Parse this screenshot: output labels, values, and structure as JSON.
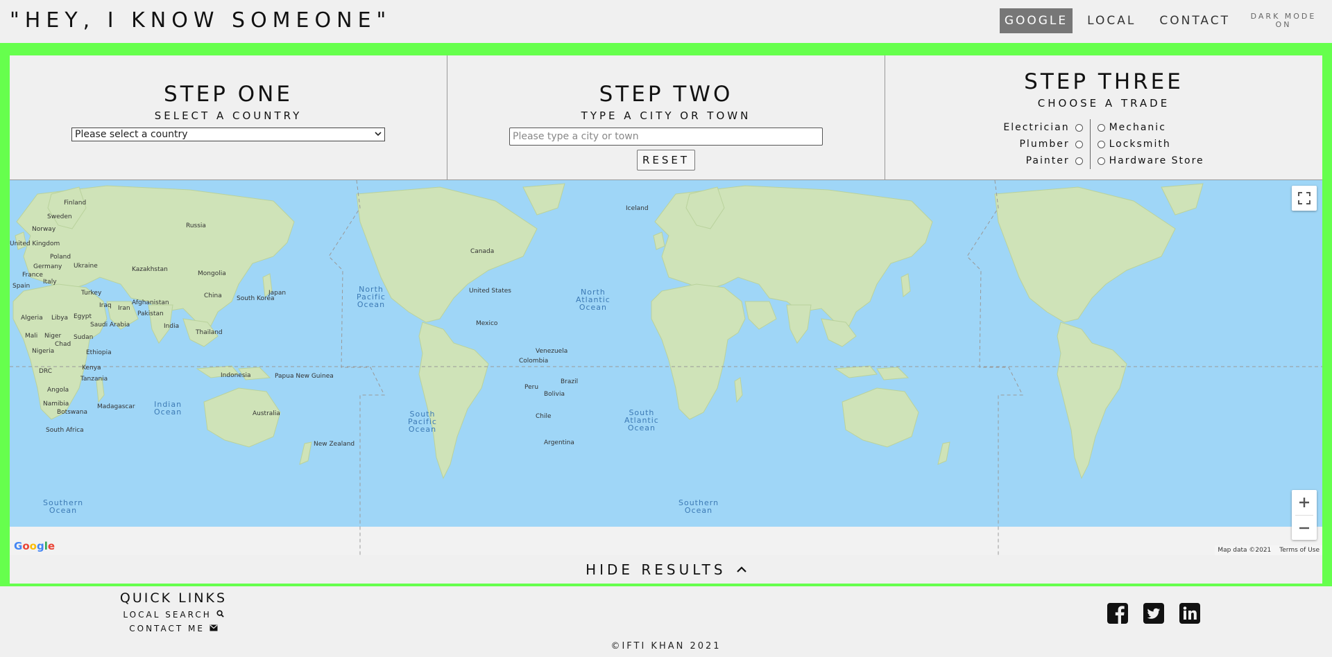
{
  "header": {
    "title": "\"HEY, I KNOW SOMEONE\"",
    "nav": [
      "GOOGLE",
      "LOCAL",
      "CONTACT"
    ],
    "dark_mode_line1": "DARK MODE",
    "dark_mode_line2": "ON"
  },
  "steps": {
    "one": {
      "title": "STEP ONE",
      "subtitle": "SELECT A COUNTRY",
      "select_value": "Please select a country"
    },
    "two": {
      "title": "STEP TWO",
      "subtitle": "TYPE A CITY OR TOWN",
      "placeholder": "Please type a city or town",
      "reset_label": "RESET"
    },
    "three": {
      "title": "STEP THREE",
      "subtitle": "CHOOSE A TRADE",
      "trades_left": [
        "Electrician",
        "Plumber",
        "Painter"
      ],
      "trades_right": [
        "Mechanic",
        "Locksmith",
        "Hardware Store"
      ]
    }
  },
  "map": {
    "labels": [
      "Finland",
      "Sweden",
      "Norway",
      "Russia",
      "United Kingdom",
      "Poland",
      "Germany",
      "Ukraine",
      "France",
      "Kazakhstan",
      "Mongolia",
      "Spain",
      "Italy",
      "Turkey",
      "China",
      "South Korea",
      "Japan",
      "Iraq",
      "Iran",
      "Afghanistan",
      "Pakistan",
      "Algeria",
      "Libya",
      "Egypt",
      "Saudi Arabia",
      "India",
      "Thailand",
      "Mali",
      "Niger",
      "Sudan",
      "Chad",
      "Nigeria",
      "Ethiopia",
      "DRC",
      "Kenya",
      "Tanzania",
      "Indonesia",
      "Papua New Guinea",
      "Angola",
      "Namibia",
      "Botswana",
      "Madagascar",
      "South Africa",
      "Australia",
      "New Zealand",
      "Canada",
      "United States",
      "Mexico",
      "Venezuela",
      "Colombia",
      "Peru",
      "Brazil",
      "Bolivia",
      "Chile",
      "Argentina",
      "Iceland"
    ],
    "oceans": {
      "north_pacific": [
        "North",
        "Pacific",
        "Ocean"
      ],
      "north_atlantic": [
        "North",
        "Atlantic",
        "Ocean"
      ],
      "indian": [
        "Indian",
        "Ocean"
      ],
      "south_pacific": [
        "South",
        "Pacific",
        "Ocean"
      ],
      "south_atlantic": [
        "South",
        "Atlantic",
        "Ocean"
      ],
      "southern": [
        "Southern",
        "Ocean"
      ]
    },
    "logo": "Google",
    "attribution": "Map data ©2021",
    "terms": "Terms of Use"
  },
  "hide_results_label": "HIDE RESULTS",
  "footer": {
    "quick_links_title": "QUICK LINKS",
    "local_search": "LOCAL SEARCH",
    "contact_me": "CONTACT ME",
    "copyright": "©IFTI KHAN 2021",
    "socials": [
      "facebook-icon",
      "twitter-icon",
      "linkedin-icon"
    ]
  },
  "colors": {
    "accent_green": "#66ff4d",
    "ocean": "#9fd6f7",
    "land": "#cfe3b8",
    "nav_active": "#777777"
  }
}
